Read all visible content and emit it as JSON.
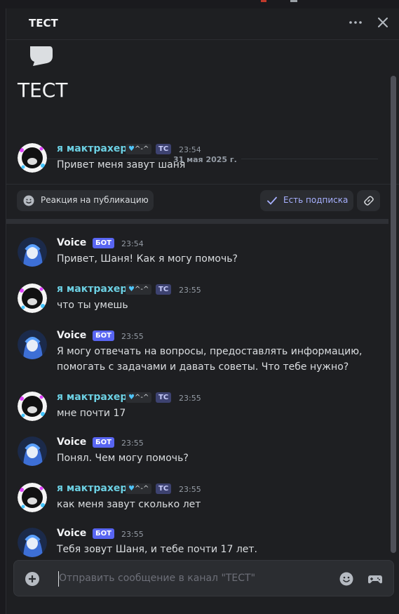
{
  "header": {
    "title": "ТЕСТ",
    "more_icon": "more-dots-icon",
    "close_icon": "close-icon"
  },
  "thread": {
    "title": "ТЕСТ",
    "icon": "chat-bubble-icon",
    "date": "31 мая 2025 г."
  },
  "original_post": {
    "author": "я мактрахер",
    "tag_text": "^-^",
    "role": "ТС",
    "time": "23:54",
    "text": "Привет меня завут шаня"
  },
  "actions": {
    "reaction_label": "Реакция на публикацию",
    "follow_label": "Есть подписка",
    "link_icon": "link-icon"
  },
  "messages": [
    {
      "author": "Voice",
      "is_bot": true,
      "badge": "БОТ",
      "time": "23:54",
      "text": "Привет, Шаня! Как я могу помочь?"
    },
    {
      "author": "я мактрахер",
      "is_bot": false,
      "tag_text": "^-^",
      "role": "ТС",
      "time": "23:55",
      "text": "что ты умешь"
    },
    {
      "author": "Voice",
      "is_bot": true,
      "badge": "БОТ",
      "time": "23:55",
      "text": "Я могу отвечать на вопросы, предоставлять информацию, помогать с задачами и давать советы. Что тебе нужно?"
    },
    {
      "author": "я мактрахер",
      "is_bot": false,
      "tag_text": "^-^",
      "role": "ТС",
      "time": "23:55",
      "text": "мне почти 17"
    },
    {
      "author": "Voice",
      "is_bot": true,
      "badge": "БОТ",
      "time": "23:55",
      "text": "Понял. Чем могу помочь?"
    },
    {
      "author": "я мактрахер",
      "is_bot": false,
      "tag_text": "^-^",
      "role": "ТС",
      "time": "23:55",
      "text": "как меня завут сколько лет"
    },
    {
      "author": "Voice",
      "is_bot": true,
      "badge": "БОТ",
      "time": "23:55",
      "text": "Тебя зовут Шаня, и тебе почти 17 лет."
    }
  ],
  "composer": {
    "placeholder": "Отправить сообщение в канал \"ТЕСТ\"",
    "value": "",
    "plus_icon": "plus-circle-icon",
    "emoji_icon": "emoji-icon",
    "game_icon": "gamepad-icon"
  },
  "colors": {
    "background": "#1e1f22",
    "user_name": "#6cd0e3",
    "bot_badge": "#5865f2",
    "accent_follow": "#a7b0ff"
  }
}
